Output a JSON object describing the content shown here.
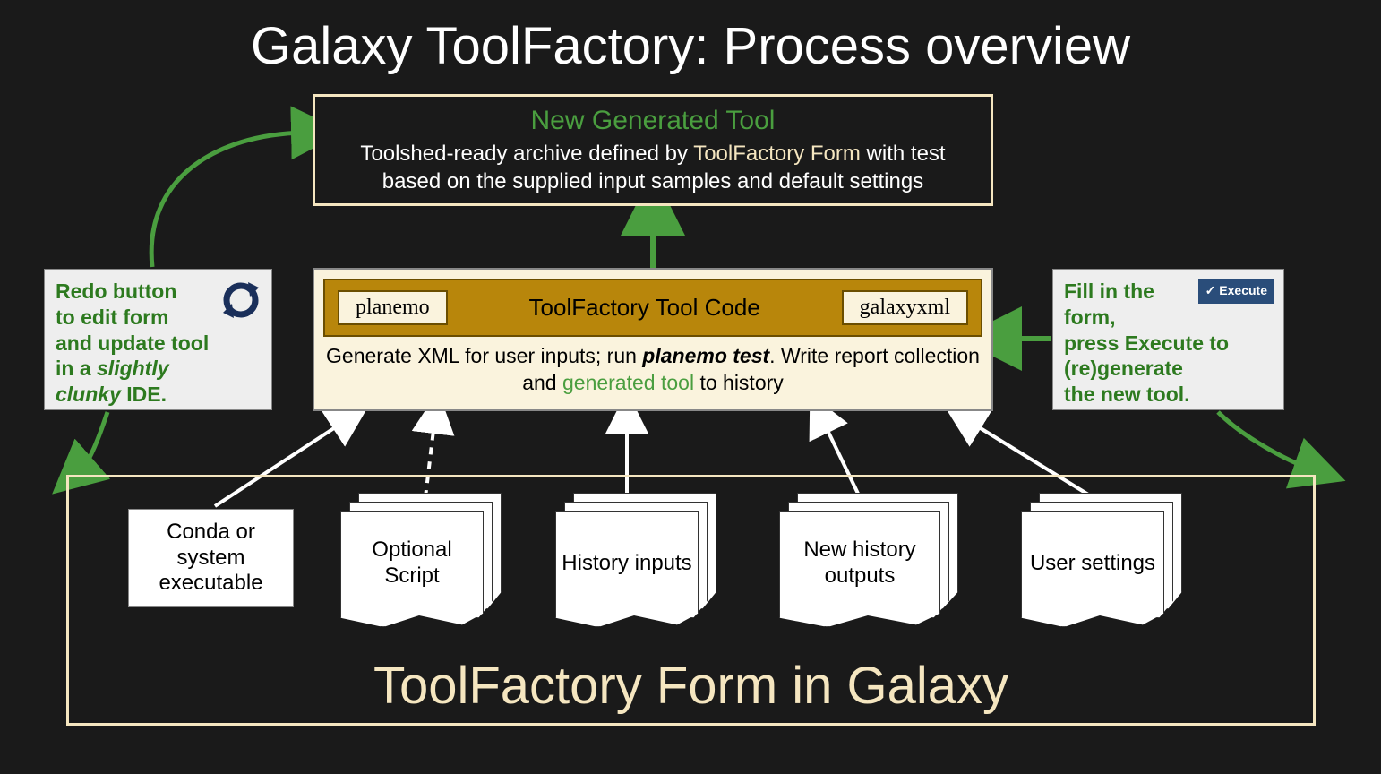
{
  "title": "Galaxy ToolFactory: Process overview",
  "generated_tool": {
    "heading": "New Generated Tool",
    "desc_pre": "Toolshed-ready archive defined by ",
    "desc_highlight": "ToolFactory Form",
    "desc_post": " with test based on the supplied input samples and default settings"
  },
  "code_box": {
    "chip_left": "planemo",
    "header_title": "ToolFactory Tool Code",
    "chip_right": "galaxyxml",
    "desc_1": "Generate XML for user inputs; run ",
    "desc_em": "planemo test",
    "desc_2": ". Write report collection and ",
    "desc_green": "generated tool",
    "desc_3": " to history"
  },
  "left_note": {
    "l1": "Redo button",
    "l2": "to edit form",
    "l3": "and update tool",
    "l4a": "in a ",
    "l4b": "slightly",
    "l5a": "clunky",
    "l5b": " IDE."
  },
  "right_note": {
    "l1": "Fill in the",
    "l2": "form,",
    "l3": "press Execute to",
    "l4": "(re)generate",
    "l5": "the new tool.",
    "execute_label": "Execute"
  },
  "form": {
    "title": "ToolFactory Form in Galaxy",
    "cards": {
      "conda": "Conda or system executable",
      "script": "Optional Script",
      "history_in": "History inputs",
      "history_out": "New history outputs",
      "settings": "User settings"
    }
  }
}
